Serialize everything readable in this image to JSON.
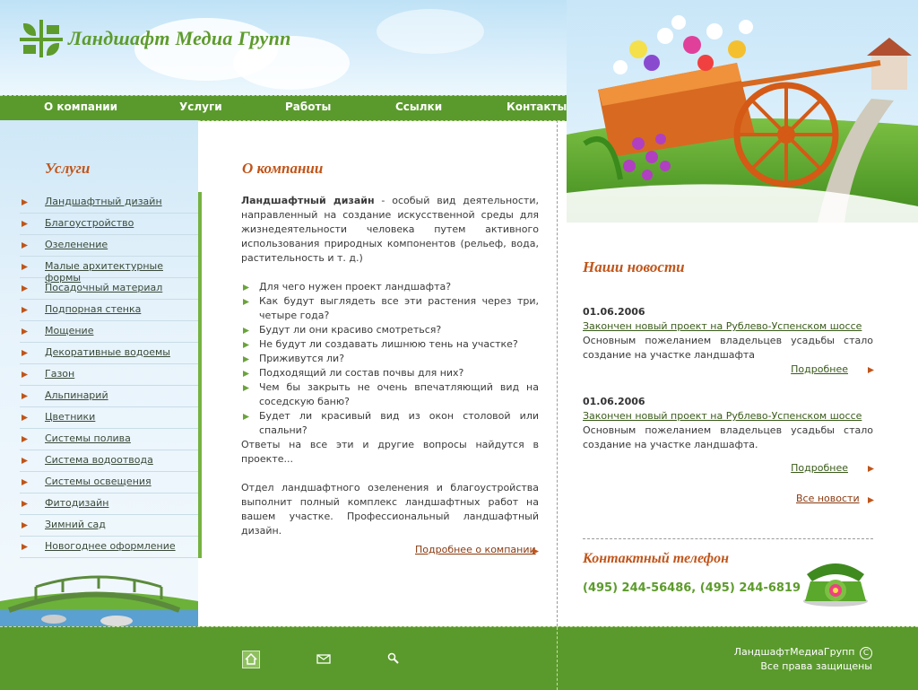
{
  "header": {
    "logo_text": "Ландшафт Медиа Групп"
  },
  "nav": {
    "items": [
      "О компании",
      "Услуги",
      "Работы",
      "Ссылки",
      "Контакты"
    ]
  },
  "sidebar": {
    "title": "Услуги",
    "items": [
      "Ландшафтный дизайн",
      "Благоустройство",
      "Озеленение",
      "Малые архитектурные формы",
      "Посадочный материал",
      "Подпорная стенка",
      "Мощение",
      "Декоративные водоемы",
      "Газон",
      "Альпинарий",
      "Цветники",
      "Системы полива",
      "Система водоотвода",
      "Системы освещения",
      "Фитодизайн",
      "Зимний сад",
      "Новогоднее оформление"
    ]
  },
  "main": {
    "title": "О компании",
    "intro_bold": "Ландшафтный дизайн",
    "intro_rest": " - особый вид деятельности, направленный на создание искусственной среды для жизнедеятельности человека путем активного использования природных компонентов (рельеф, вода, растительность и т. д.)",
    "questions": [
      "Для чего нужен проект ландшафта?",
      "Как будут выглядеть все эти растения через три, четыре года?",
      "Будут ли они красиво смотреться?",
      "Не будут ли создавать лишнюю тень на участке?",
      "Приживутся ли?",
      "Подходящий ли состав почвы для них?",
      "Чем бы закрыть не очень впечатляющий вид на соседскую баню?",
      "Будет ли красивый вид из окон столовой или спальни?"
    ],
    "answer": "Ответы на все эти и другие вопросы найдутся в проекте...",
    "paragraph2": "Отдел ландшафтного озеленения и благоустройства выполнит полный комплекс ландшафтных работ на вашем участке. Профессиональный ландшафтный дизайн.",
    "more_link": "Подробнее о компании"
  },
  "news": {
    "title": "Наши новости",
    "items": [
      {
        "date": "01.06.2006",
        "headline": "Закончен новый проект на Рублево-Успенском шоссе",
        "text": "Основным пожеланием владельцев усадьбы стало создание на участке ландшафта",
        "more": "Подробнее"
      },
      {
        "date": "01.06.2006",
        "headline": "Закончен новый проект на Рублево-Успенском шоссе",
        "text": "Основным пожеланием владельцев усадьбы стало создание на участке ландшафта.",
        "more": "Подробнее"
      }
    ],
    "all_link": "Все новости"
  },
  "contact": {
    "title": "Контактный телефон",
    "phone": "(495) 244-56486, (495) 244-6819"
  },
  "footer": {
    "copyright_name": "ЛандшафтМедиаГрупп",
    "copyright_symbol": "C",
    "rights": "Все права защищены",
    "icons": [
      "home-icon",
      "mail-icon",
      "search-icon"
    ]
  },
  "colors": {
    "green": "#5a9a2c",
    "orange": "#c0551a",
    "sky": "#cfe8f7"
  }
}
